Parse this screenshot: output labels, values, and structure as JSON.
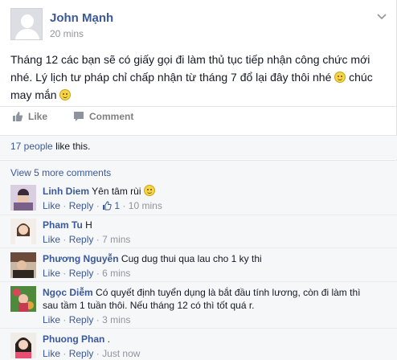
{
  "post": {
    "author": "John Mạnh",
    "time": "20 mins",
    "text_line1": "Tháng 12 các bạn sẽ có giấy gọi đi làm thủ tục tiếp nhận công chức mới",
    "text_line2": "nhé. Lý lịch tư pháp chỉ chấp nhận từ tháng 7 đổ lại đây thôi nhé",
    "text_line2_tail": "chúc",
    "text_line3": "may mắn"
  },
  "actions": {
    "like_label": "Like",
    "comment_label": "Comment"
  },
  "likes": {
    "count_text": "17 people",
    "suffix": "like this."
  },
  "comments_section": {
    "view_more": "View 5 more comments"
  },
  "comments": [
    {
      "name": "Linh Diem",
      "text": "Yên tâm rùi",
      "like": "Like",
      "reply": "Reply",
      "like_count": "1",
      "time": "10 mins"
    },
    {
      "name": "Pham Tu",
      "text": "H",
      "like": "Like",
      "reply": "Reply",
      "time": "7 mins"
    },
    {
      "name": "Phương Nguyễn",
      "text": "Cug dug thui qua lau cho 1 ky thi",
      "like": "Like",
      "reply": "Reply",
      "time": "6 mins"
    },
    {
      "name": "Ngọc Diễm",
      "text": "Có quyết định tuyển dụng là bắt đầu tính lương, còn đi làm thì",
      "text2": "sau tầm 1 tuần thôi. Nếu tháng 12 có thì tốt quá r.",
      "like": "Like",
      "reply": "Reply",
      "time": "3 mins"
    },
    {
      "name": "Phuong Phan",
      "text": ".",
      "like": "Like",
      "reply": "Reply",
      "time": "Just now"
    }
  ],
  "meta_sep": "·",
  "colors": {
    "link": "#3b5998",
    "muted": "#90949c",
    "bg_light": "#f6f7f9"
  }
}
